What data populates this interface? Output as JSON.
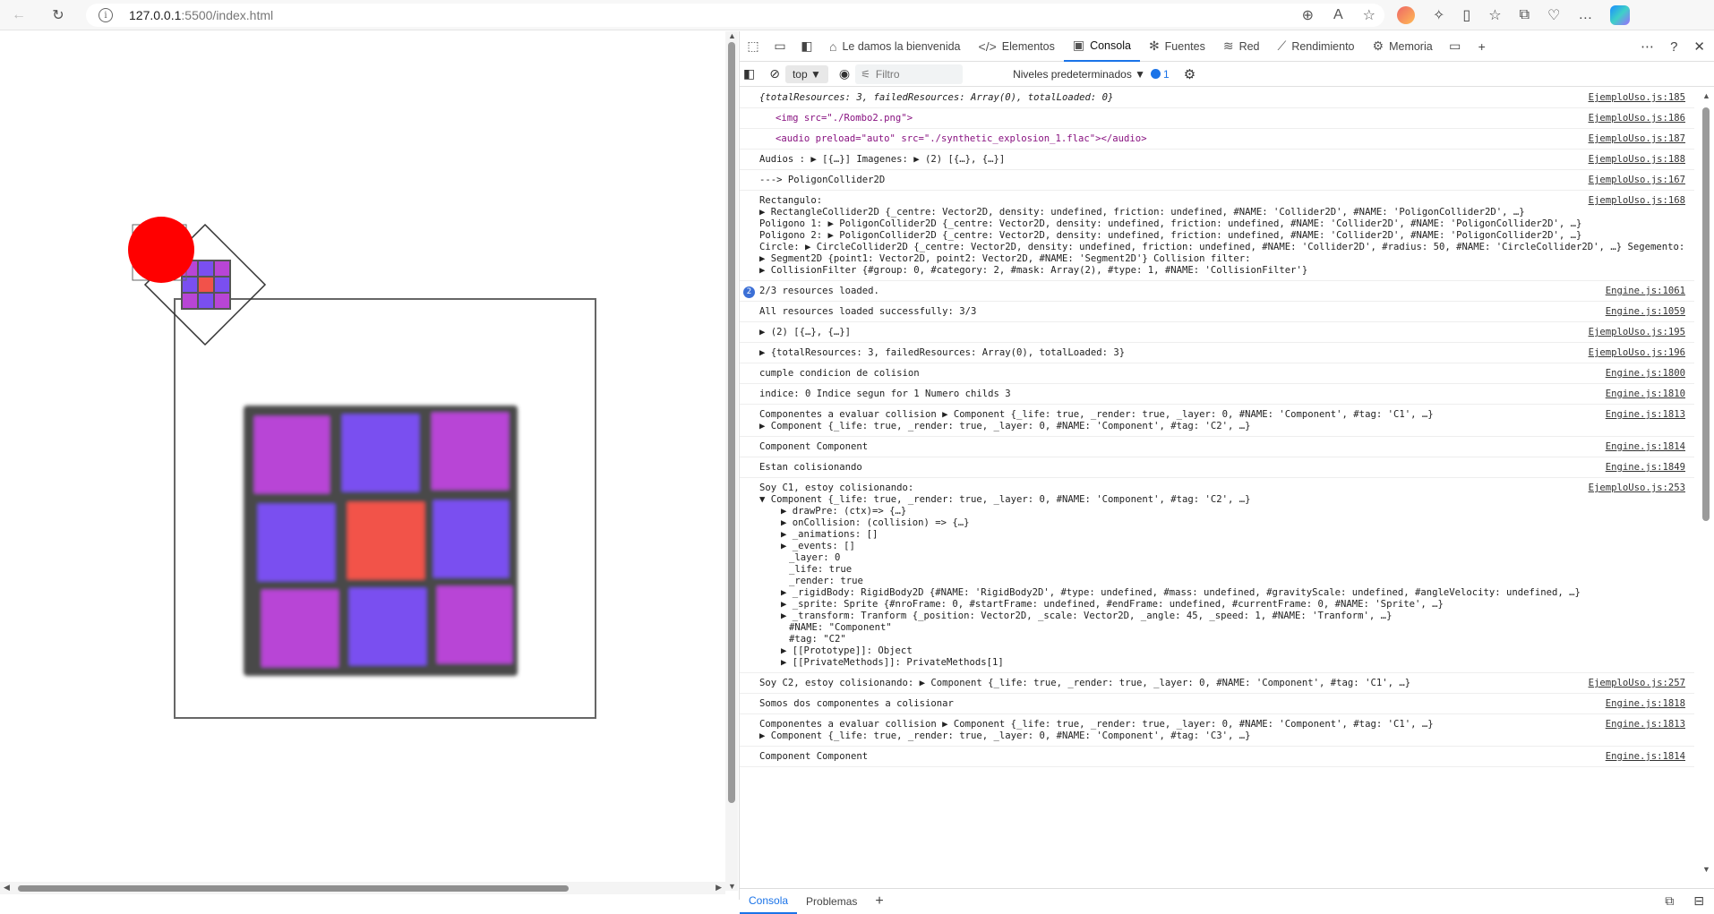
{
  "browser": {
    "url_host": "127.0.0.1",
    "url_rest": ":5500/index.html"
  },
  "devtools": {
    "tabs": [
      {
        "label": "Le damos la bienvenida",
        "icon": "home-icon"
      },
      {
        "label": "Elementos",
        "icon": "code-icon"
      },
      {
        "label": "Consola",
        "icon": "console-icon"
      },
      {
        "label": "Fuentes",
        "icon": "bug-icon"
      },
      {
        "label": "Red",
        "icon": "wifi-icon"
      },
      {
        "label": "Rendimiento",
        "icon": "performance-icon"
      },
      {
        "label": "Memoria",
        "icon": "memory-icon"
      }
    ],
    "context": "top",
    "filter_placeholder": "Filtro",
    "levels": "Niveles predeterminados",
    "issues_count": "1",
    "bottom_tabs": [
      "Consola",
      "Problemas"
    ]
  },
  "console": {
    "rows": [
      {
        "text": "{totalResources: 3, failedResources: Array(0), totalLoaded: 0}",
        "src": "EjemploUso.js:185"
      },
      {
        "text": "<img src=\"./Rombo2.png\">",
        "src": "EjemploUso.js:186"
      },
      {
        "text": "<audio preload=\"auto\" src=\"./synthetic_explosion_1.flac\"></audio>",
        "src": "EjemploUso.js:187"
      },
      {
        "text": "Audios : ▶ [{…}]  Imagenes: ▶ (2) [{…}, {…}]",
        "src": "EjemploUso.js:188"
      },
      {
        "text": "---> PoligonCollider2D",
        "src": "EjemploUso.js:167"
      },
      {
        "lines": [
          "Rectangulo:",
          "▶ RectangleCollider2D {_centre: Vector2D, density: undefined, friction: undefined, #NAME: 'Collider2D', #NAME: 'PoligonCollider2D', …}",
          "Poligono 1:  ▶ PoligonCollider2D {_centre: Vector2D, density: undefined, friction: undefined, #NAME: 'Collider2D', #NAME: 'PoligonCollider2D', …}",
          "Poligono 2:  ▶ PoligonCollider2D {_centre: Vector2D, density: undefined, friction: undefined, #NAME: 'Collider2D', #NAME: 'PoligonCollider2D', …}",
          "Circle:  ▶ CircleCollider2D {_centre: Vector2D, density: undefined, friction: undefined, #NAME: 'Collider2D', #radius: 50, #NAME: 'CircleCollider2D', …}  Segemento:",
          "▶ Segment2D {point1: Vector2D, point2: Vector2D, #NAME: 'Segment2D'} Collision filter:",
          "▶ CollisionFilter {#group: 0, #category: 2, #mask: Array(2), #type: 1, #NAME: 'CollisionFilter'}"
        ],
        "src": "EjemploUso.js:168"
      },
      {
        "badge": "2",
        "text": "2/3 resources loaded.",
        "src": "Engine.js:1061"
      },
      {
        "text": "All resources loaded successfully: 3/3",
        "src": "Engine.js:1059"
      },
      {
        "text": "▶ (2) [{…}, {…}]",
        "src": "EjemploUso.js:195"
      },
      {
        "text": "▶ {totalResources: 3, failedResources: Array(0), totalLoaded: 3}",
        "src": "EjemploUso.js:196"
      },
      {
        "text": "cumple condicion de colision",
        "src": "Engine.js:1800"
      },
      {
        "text": "indice: 0  Indice segun for 1  Numero childs 3",
        "src": "Engine.js:1810"
      },
      {
        "lines": [
          "Componentes a evaluar collision  ▶ Component {_life: true, _render: true, _layer: 0, #NAME: 'Component', #tag: 'C1', …}",
          "▶ Component {_life: true, _render: true, _layer: 0, #NAME: 'Component', #tag: 'C2', …}"
        ],
        "src": "Engine.js:1813"
      },
      {
        "text": "Component Component",
        "src": "Engine.js:1814"
      },
      {
        "text": "Estan colisionando",
        "src": "Engine.js:1849"
      },
      {
        "lines": [
          "Soy C1, estoy colisionando:",
          "▼ Component {_life: true, _render: true, _layer: 0, #NAME: 'Component', #tag: 'C2', …}",
          "▶ drawPre: (ctx)=> {…}",
          "▶ onCollision: (collision) => {…}",
          "▶ _animations: []",
          "▶ _events: []",
          "_layer: 0",
          "_life: true",
          "_render: true",
          "▶ _rigidBody: RigidBody2D {#NAME: 'RigidBody2D', #type: undefined, #mass: undefined, #gravityScale: undefined, #angleVelocity: undefined, …}",
          "▶ _sprite: Sprite {#nroFrame: 0, #startFrame: undefined, #endFrame: undefined, #currentFrame: 0, #NAME: 'Sprite', …}",
          "▶ _transform: Tranform {_position: Vector2D, _scale: Vector2D, _angle: 45, _speed: 1, #NAME: 'Tranform', …}",
          "#NAME: \"Component\"",
          "#tag: \"C2\"",
          "▶ [[Prototype]]: Object",
          "▶ [[PrivateMethods]]: PrivateMethods[1]"
        ],
        "src": "EjemploUso.js:253"
      },
      {
        "text": "Soy C2, estoy colisionando:  ▶ Component {_life: true, _render: true, _layer: 0, #NAME: 'Component', #tag: 'C1', …}",
        "src": "EjemploUso.js:257"
      },
      {
        "text": "Somos dos componentes a colisionar",
        "src": "Engine.js:1818"
      },
      {
        "lines": [
          "Componentes a evaluar collision  ▶ Component {_life: true, _render: true, _layer: 0, #NAME: 'Component', #tag: 'C1', …}",
          "▶ Component {_life: true, _render: true, _layer: 0, #NAME: 'Component', #tag: 'C3', …}"
        ],
        "src": "Engine.js:1813"
      },
      {
        "text": "Component Component",
        "src": "Engine.js:1814"
      }
    ]
  },
  "canvas": {
    "colors": {
      "purple": "#b845d6",
      "violet": "#7a4ff0",
      "red": "#f2524a",
      "border": "#555555",
      "circle": "#ff0000"
    }
  }
}
